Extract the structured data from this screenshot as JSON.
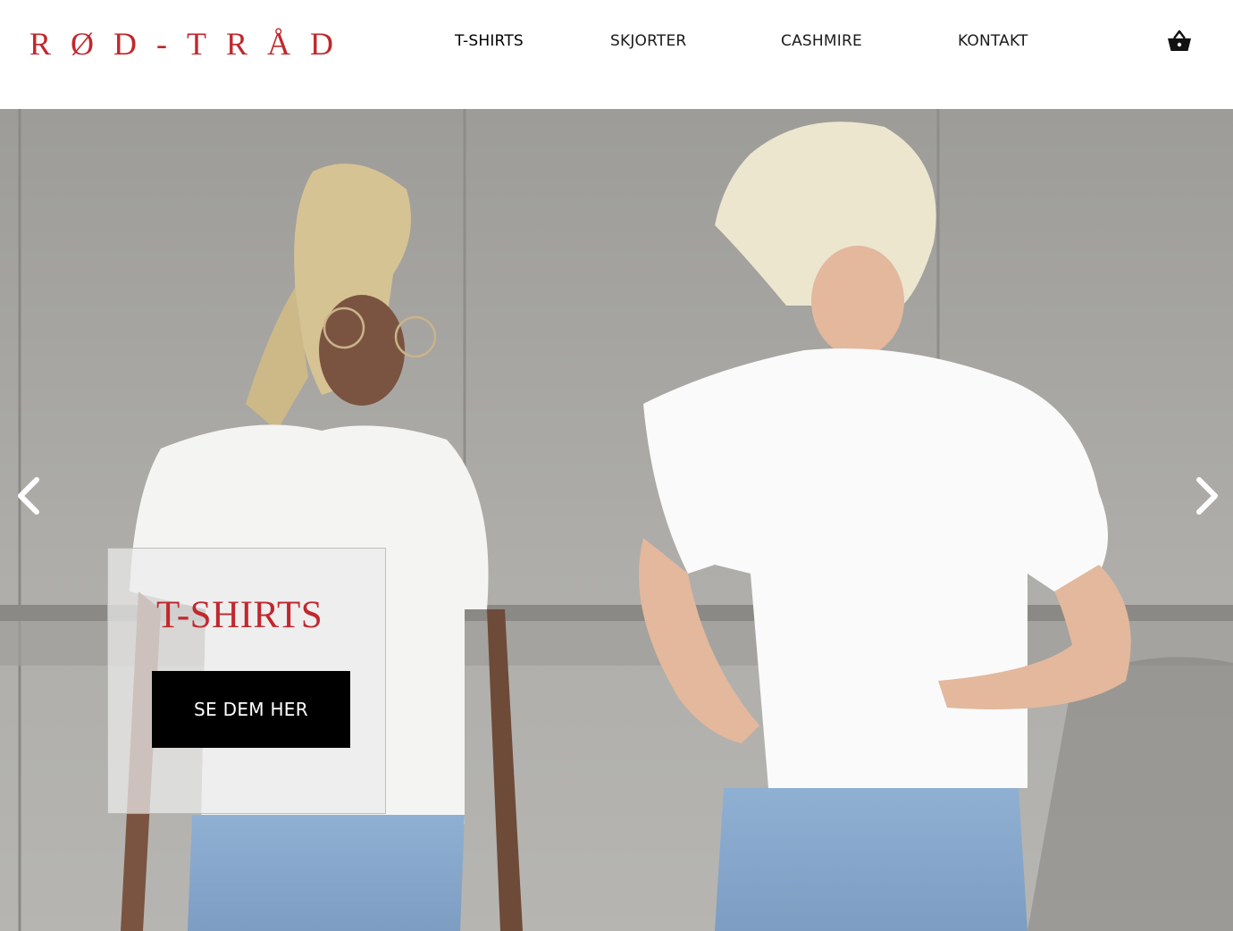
{
  "brand": {
    "logo_text": "RØD-TRÅD",
    "accent_color": "#c0282d"
  },
  "nav": {
    "items": [
      {
        "label": "T-SHIRTS"
      },
      {
        "label": "SKJORTER"
      },
      {
        "label": "CASHMIRE"
      },
      {
        "label": "KONTAKT"
      }
    ]
  },
  "header": {
    "cart_icon": "basket-icon"
  },
  "hero": {
    "prev_icon": "chevron-left-icon",
    "next_icon": "chevron-right-icon",
    "promo": {
      "title": "T-SHIRTS",
      "button_label": "SE DEM HER"
    }
  }
}
